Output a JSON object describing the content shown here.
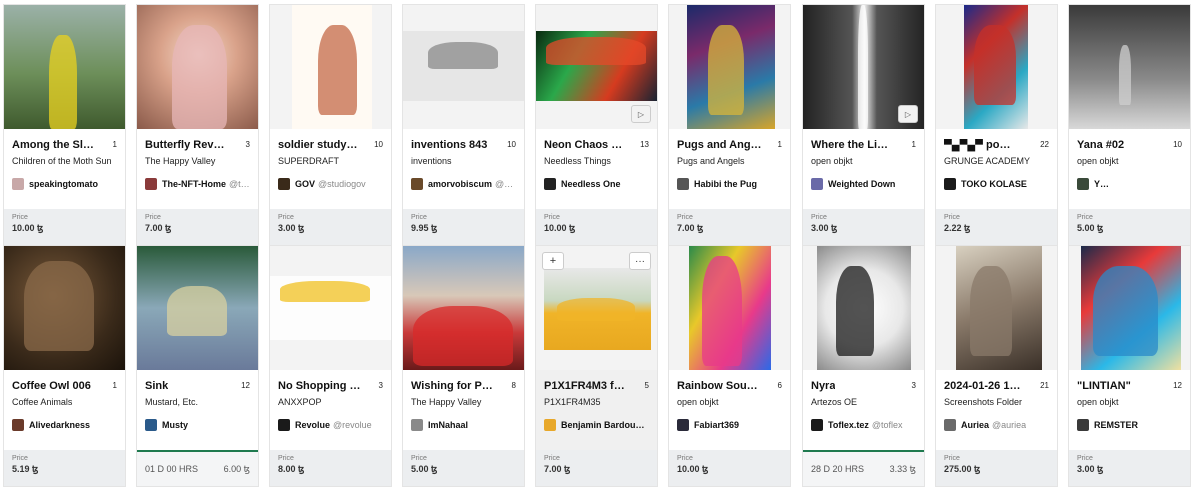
{
  "price_label": "Price",
  "cards": [
    {
      "title": "Among the Sl…",
      "edition": "1",
      "collection": "Children of the Moth Sun",
      "creator": "speakingtomato",
      "handle": "",
      "price": "10.00 ꜩ"
    },
    {
      "title": "Butterfly Rev…",
      "edition": "3",
      "collection": "The Happy Valley",
      "creator": "The-NFT-Home",
      "handle": "@t…",
      "price": "7.00 ꜩ"
    },
    {
      "title": "soldier study…",
      "edition": "10",
      "collection": "SUPERDRAFT",
      "creator": "GOV",
      "handle": "@studiogov",
      "price": "3.00 ꜩ"
    },
    {
      "title": "inventions 843",
      "edition": "10",
      "collection": "inventions",
      "creator": "amorvobiscum",
      "handle": "@a…",
      "price": "9.95 ꜩ"
    },
    {
      "title": "Neon Chaos …",
      "edition": "13",
      "collection": "Needless Things",
      "creator": "Needless One",
      "handle": "",
      "price": "10.00 ꜩ",
      "play": "▷"
    },
    {
      "title": "Pugs and Ang…",
      "edition": "1",
      "collection": "Pugs and Angels",
      "creator": "Habibi the Pug",
      "handle": "",
      "price": "7.00 ꜩ"
    },
    {
      "title": "Where the Li…",
      "edition": "1",
      "collection": "open objkt",
      "creator": "Weighted Down",
      "handle": "",
      "price": "3.00 ꜩ",
      "play": "▷"
    },
    {
      "title": "▀▄▀▄▀ po…",
      "edition": "22",
      "collection": "GRUNGE ACADEMY",
      "creator": "TOKO KOLASE",
      "handle": "",
      "price": "2.22 ꜩ"
    },
    {
      "title": "Yana #02",
      "edition": "10",
      "collection": "open objkt",
      "creator": "Y…",
      "handle": "",
      "price": "5.00 ꜩ"
    },
    {
      "title": "Coffee Owl 006",
      "edition": "1",
      "collection": "Coffee Animals",
      "creator": "Alivedarkness",
      "handle": "",
      "price": "5.19 ꜩ"
    },
    {
      "title": "Sink",
      "edition": "12",
      "collection": "Mustard, Etc.",
      "creator": "Musty",
      "handle": "",
      "auction": {
        "time": "01 D   00 HRS",
        "amount": "6.00 ꜩ"
      }
    },
    {
      "title": "No Shopping …",
      "edition": "3",
      "collection": "ANXXPOP",
      "creator": "Revolue",
      "handle": "@revolue",
      "price": "8.00 ꜩ"
    },
    {
      "title": "Wishing for P…",
      "edition": "8",
      "collection": "The Happy Valley",
      "creator": "ImNahaal",
      "handle": "",
      "price": "5.00 ꜩ"
    },
    {
      "title": "P1X1FR4M3 f…",
      "edition": "5",
      "collection": "P1X1FR4M35",
      "creator": "Benjamin Bardou…",
      "handle": "",
      "price": "7.00 ꜩ",
      "hover": true,
      "plus": "+",
      "more": "···"
    },
    {
      "title": "Rainbow Sou…",
      "edition": "6",
      "collection": "open objkt",
      "creator": "Fabiart369",
      "handle": "",
      "price": "10.00 ꜩ"
    },
    {
      "title": "Nyra",
      "edition": "3",
      "collection": "Artezos OE",
      "creator": "Toflex.tez",
      "handle": "@toflex",
      "auction": {
        "time": "28 D   20 HRS",
        "amount": "3.33 ꜩ"
      }
    },
    {
      "title": "2024-01-26 1…",
      "edition": "21",
      "collection": "Screenshots Folder",
      "creator": "Auriea",
      "handle": "@auriea",
      "price": "275.00 ꜩ"
    },
    {
      "title": "\"LINTIAN\"",
      "edition": "12",
      "collection": "open objkt",
      "creator": "REMSTER",
      "handle": "",
      "price": "3.00 ꜩ"
    }
  ]
}
